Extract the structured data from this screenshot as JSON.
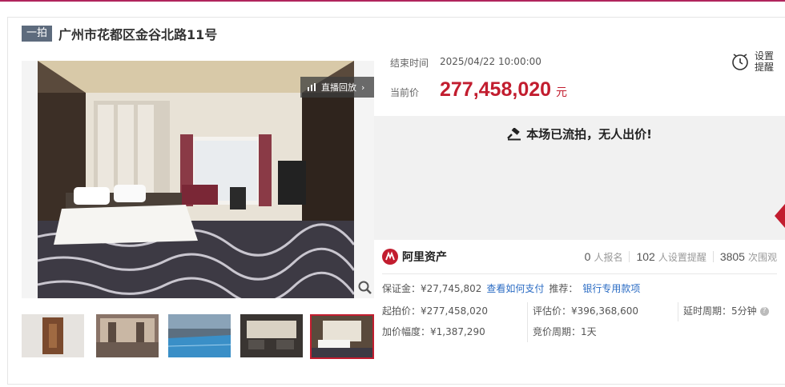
{
  "header": {
    "badge": "一拍",
    "title": "广州市花都区金谷北路11号"
  },
  "gallery": {
    "replay_label": "直播回放",
    "thumb_count": 5,
    "selected_index": 4
  },
  "auction": {
    "end_time_label": "结束时间",
    "end_time": "2025/04/22 10:00:00",
    "remind_label_1": "设置",
    "remind_label_2": "提醒",
    "price_label": "当前价",
    "price": "277,458,020",
    "price_unit": "元",
    "status": "本场已流拍，无人出价!"
  },
  "platform": {
    "name": "阿里资产",
    "signups": "0",
    "signups_label": "人报名",
    "reminders": "102",
    "reminders_label": "人设置提醒",
    "views": "3805",
    "views_label": "次围观"
  },
  "details": {
    "deposit": "保证金：¥27,745,802",
    "deposit_link": "查看如何支付",
    "recommend_label": "推荐：",
    "recommend_link": "银行专用款项",
    "start_price": "起拍价：¥277,458,020",
    "increment": "加价幅度：¥1,387,290",
    "appraisal": "评估价：¥396,368,600",
    "cycle": "竞价周期：1天",
    "delay": "延时周期：5分钟",
    "help_glyph": "?"
  },
  "colors": {
    "accent": "#c21d2f",
    "link": "#2b6cc4",
    "badge": "#5d6b7d",
    "brand_line": "#b0245c"
  }
}
